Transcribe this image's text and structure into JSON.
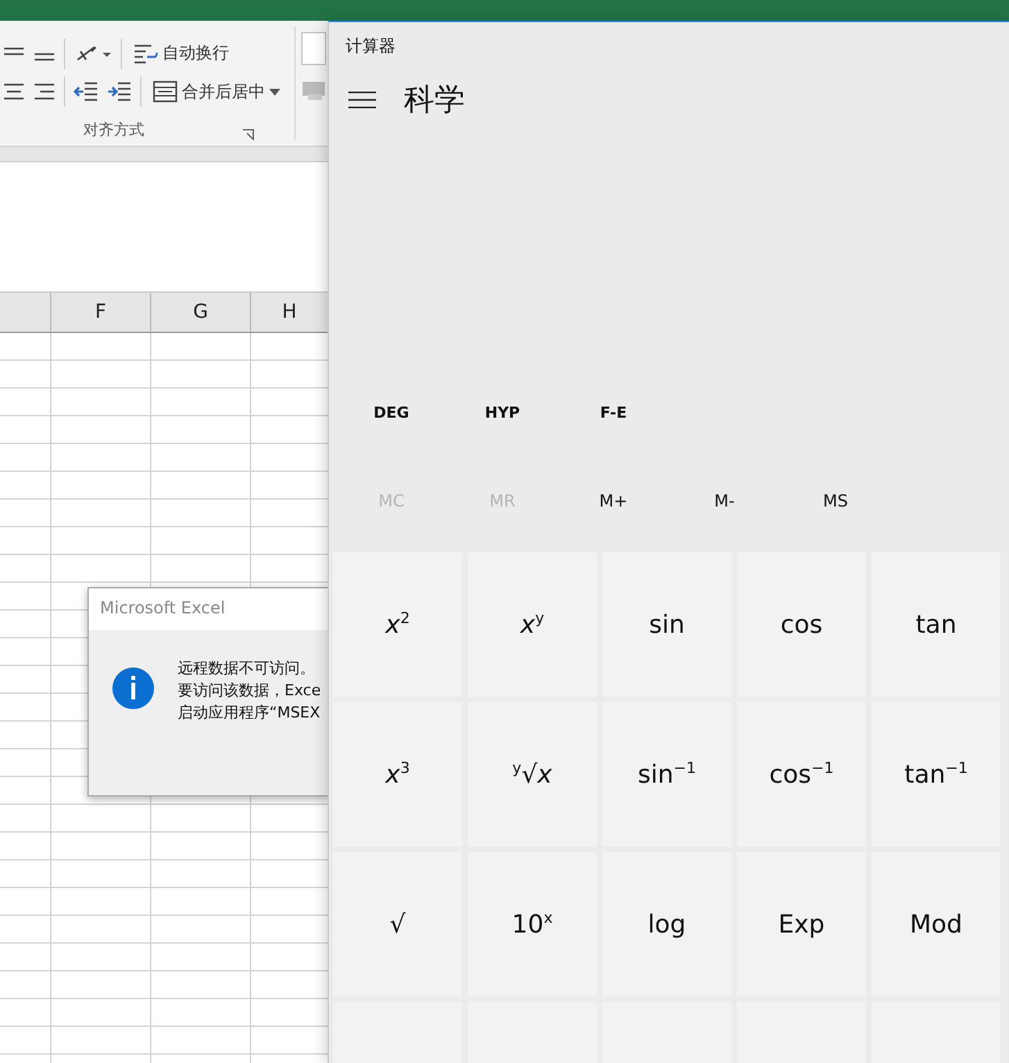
{
  "excel": {
    "ribbon": {
      "wrap_text": "自动换行",
      "merge_center": "合并后居中",
      "group_label": "对齐方式"
    },
    "columns": [
      "F",
      "G",
      "H"
    ],
    "dialog": {
      "title": "Microsoft Excel",
      "lines": [
        "远程数据不可访问。",
        "要访问该数据，Exce",
        "启动应用程序“MSEX"
      ]
    }
  },
  "calculator": {
    "title": "计算器",
    "mode": "科学",
    "mode_buttons": [
      "DEG",
      "HYP",
      "F-E"
    ],
    "memory_buttons": [
      {
        "label": "MC",
        "disabled": true
      },
      {
        "label": "MR",
        "disabled": true
      },
      {
        "label": "M+",
        "disabled": false
      },
      {
        "label": "M-",
        "disabled": false
      },
      {
        "label": "MS",
        "disabled": false
      }
    ],
    "keys": [
      [
        "*x*$^{2}$",
        "*x*$^{y}$",
        "sin",
        "cos",
        "tan"
      ],
      [
        "*x*$^{3}$",
        "$^{y}$√*x*",
        "sin$^{−1}$",
        "cos$^{−1}$",
        "tan$^{−1}$"
      ],
      [
        "√",
        "10$^{x}$",
        "log",
        "Exp",
        "Mod"
      ]
    ]
  }
}
